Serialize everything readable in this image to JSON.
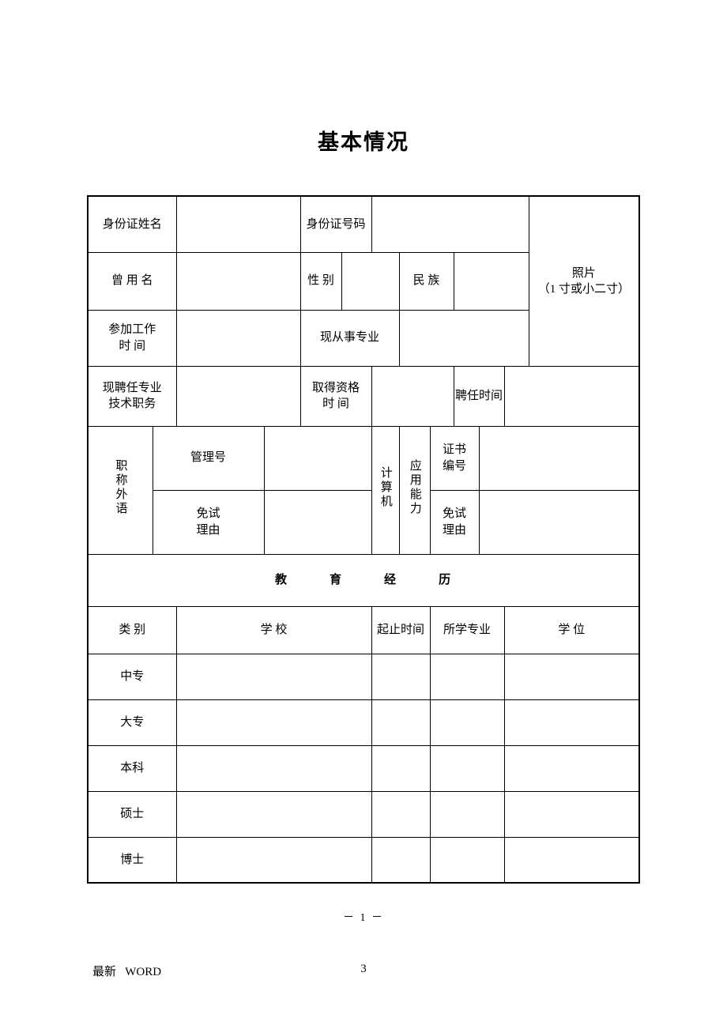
{
  "document": {
    "title": "基本情况",
    "page_marker": "－ 1 －",
    "footer_left": "最新   WORD",
    "footer_page": "3"
  },
  "basic_info": {
    "row1": {
      "label_name": "身份证姓名",
      "value_name": "",
      "label_id": "身份证号码",
      "value_id": ""
    },
    "row2": {
      "label_former_name": "曾 用 名",
      "value_former_name": "",
      "label_gender": "性 别",
      "value_gender": "",
      "label_ethnicity": "民 族",
      "value_ethnicity": ""
    },
    "photo": {
      "line1": "照片",
      "line2": "（1 寸或小二寸）"
    },
    "row3": {
      "label_work_start": "参加工作\n时    间",
      "value_work_start": "",
      "label_current_major": "现从事专业",
      "value_current_major": ""
    },
    "row4": {
      "label_current_title": "现聘任专业\n技术职务",
      "value_current_title": "",
      "label_qualify_time": "取得资格\n时    间",
      "value_qualify_time": "",
      "label_appoint_time": "聘任时间",
      "value_appoint_time": ""
    },
    "row5": {
      "label_foreign_language": "职称外语",
      "label_admin_no": "管理号",
      "value_admin_no": "",
      "label_exempt_reason_1": "免试\n理由",
      "value_exempt_reason_1": "",
      "label_computer": "计算机",
      "label_app_ability": "应用能力",
      "label_cert_no": "证书\n编号",
      "value_cert_no": "",
      "label_exempt_reason_2": "免试\n理由",
      "value_exempt_reason_2": ""
    }
  },
  "education": {
    "section_title_chars": [
      "教",
      "育",
      "经",
      "历"
    ],
    "headers": [
      "类 别",
      "学        校",
      "起止时间",
      "所学专业",
      "学  位"
    ],
    "rows": [
      {
        "category": "中专",
        "school": "",
        "period": "",
        "major": "",
        "degree": ""
      },
      {
        "category": "大专",
        "school": "",
        "period": "",
        "major": "",
        "degree": ""
      },
      {
        "category": "本科",
        "school": "",
        "period": "",
        "major": "",
        "degree": ""
      },
      {
        "category": "硕士",
        "school": "",
        "period": "",
        "major": "",
        "degree": ""
      },
      {
        "category": "博士",
        "school": "",
        "period": "",
        "major": "",
        "degree": ""
      }
    ]
  }
}
